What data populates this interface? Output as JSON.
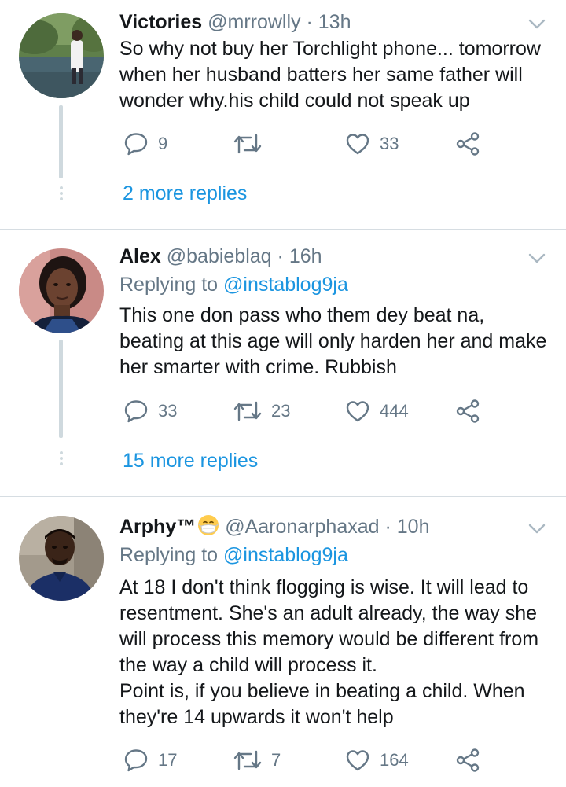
{
  "colors": {
    "link_blue": "#1b95e0",
    "secondary_gray": "#657786",
    "thread_line": "#cfd9de",
    "text": "#14171a"
  },
  "tweets": [
    {
      "name": "Victories",
      "handle": "@mrrowlly",
      "separator": "·",
      "time": "13h",
      "replying_to_label": "",
      "replying_to_handle": "",
      "lines": [
        "So why not buy her Torchlight phone... tomorrow",
        "when her husband batters her same father will",
        "wonder why.his child could not speak up"
      ],
      "reply_count": "9",
      "retweet_count": "",
      "like_count": "33",
      "more_replies": "2 more replies"
    },
    {
      "name": "Alex",
      "handle": "@babieblaq",
      "separator": "·",
      "time": "16h",
      "replying_to_label": "Replying to",
      "replying_to_handle": "@instablog9ja",
      "lines": [
        "This one don pass who them dey beat na,",
        "beating at this age will only harden her and make",
        "her smarter with crime. Rubbish"
      ],
      "reply_count": "33",
      "retweet_count": "23",
      "like_count": "444",
      "more_replies": "15 more replies"
    },
    {
      "name": "Arphy™",
      "name_emoji": "face-with-medical-mask-emoji",
      "handle": "@Aaronarphaxad",
      "separator": "·",
      "time": "10h",
      "replying_to_label": "Replying to",
      "replying_to_handle": "@instablog9ja",
      "lines": [
        "At 18 I don't think flogging is wise. It will lead to",
        "resentment. She's an adult already, the way she",
        "will process this memory would be different from",
        "the way a child will process it.",
        "Point is, if you believe in beating a child. When",
        "they're 14 upwards it won't help"
      ],
      "reply_count": "17",
      "retweet_count": "7",
      "like_count": "164",
      "more_replies": ""
    }
  ]
}
